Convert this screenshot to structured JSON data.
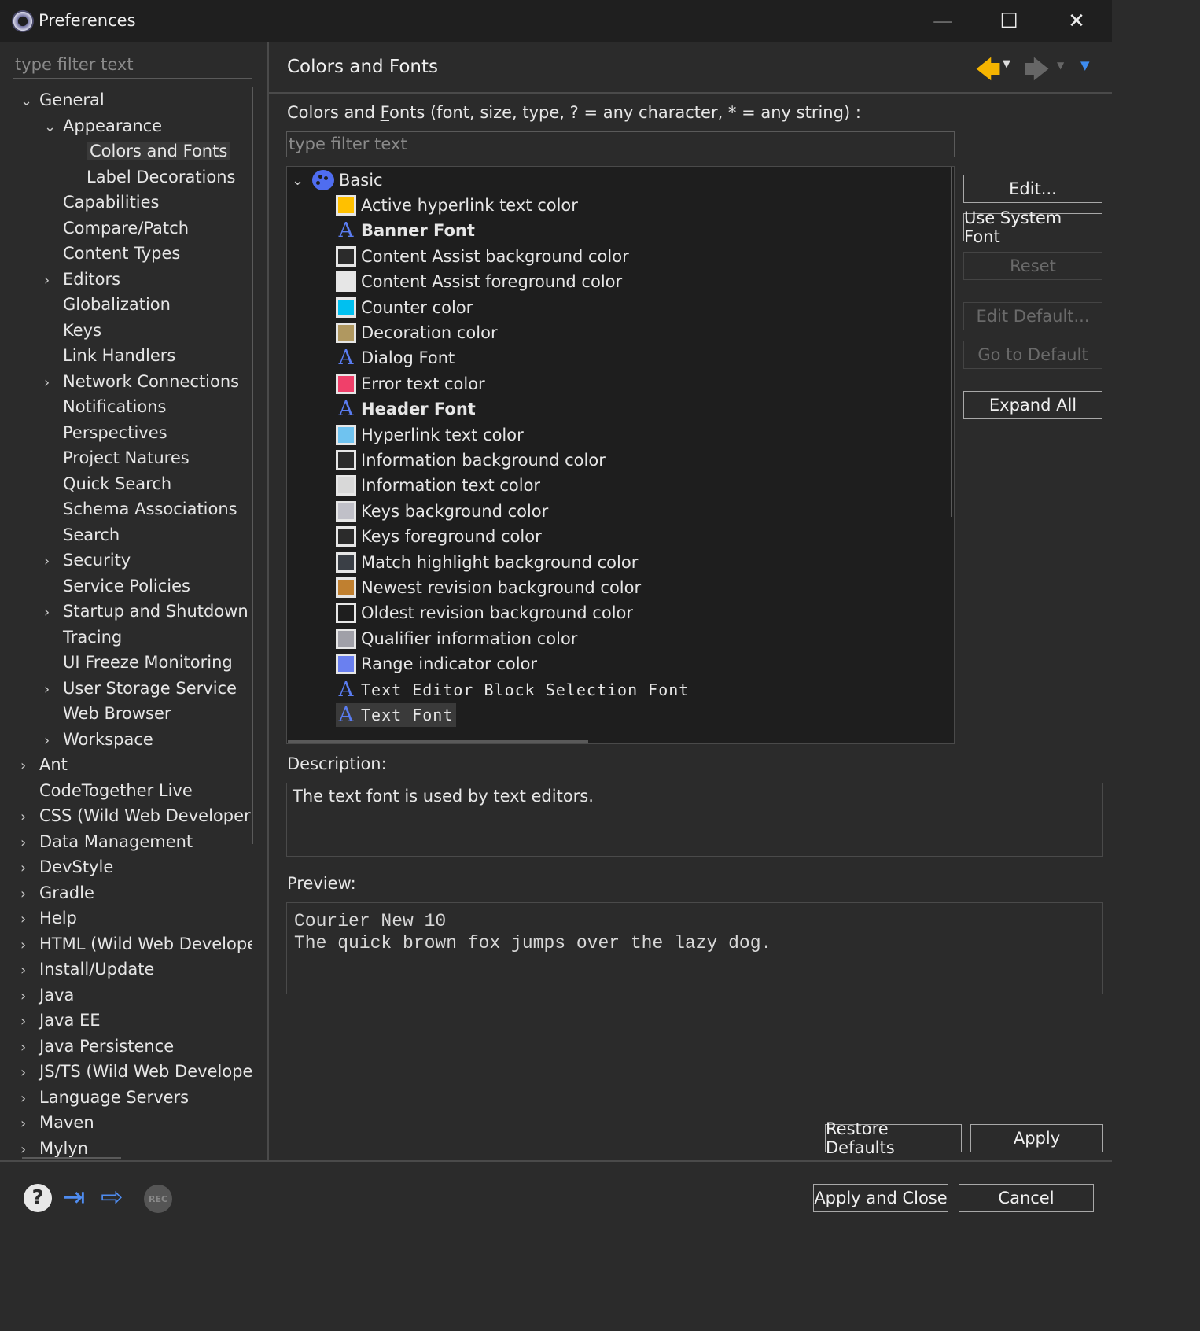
{
  "window": {
    "title": "Preferences",
    "minimize_glyph": "—",
    "maximize_glyph": "☐",
    "close_glyph": "✕"
  },
  "left": {
    "filter_placeholder": "type filter text",
    "tree": [
      {
        "label": "General",
        "level": 0,
        "arrow": "expanded"
      },
      {
        "label": "Appearance",
        "level": 1,
        "arrow": "expanded"
      },
      {
        "label": "Colors and Fonts",
        "level": 2,
        "arrow": "none",
        "selected": true
      },
      {
        "label": "Label Decorations",
        "level": 2,
        "arrow": "none"
      },
      {
        "label": "Capabilities",
        "level": 1,
        "arrow": "none"
      },
      {
        "label": "Compare/Patch",
        "level": 1,
        "arrow": "none"
      },
      {
        "label": "Content Types",
        "level": 1,
        "arrow": "none"
      },
      {
        "label": "Editors",
        "level": 1,
        "arrow": "collapsed"
      },
      {
        "label": "Globalization",
        "level": 1,
        "arrow": "none"
      },
      {
        "label": "Keys",
        "level": 1,
        "arrow": "none"
      },
      {
        "label": "Link Handlers",
        "level": 1,
        "arrow": "none"
      },
      {
        "label": "Network Connections",
        "level": 1,
        "arrow": "collapsed"
      },
      {
        "label": "Notifications",
        "level": 1,
        "arrow": "none"
      },
      {
        "label": "Perspectives",
        "level": 1,
        "arrow": "none"
      },
      {
        "label": "Project Natures",
        "level": 1,
        "arrow": "none"
      },
      {
        "label": "Quick Search",
        "level": 1,
        "arrow": "none"
      },
      {
        "label": "Schema Associations",
        "level": 1,
        "arrow": "none"
      },
      {
        "label": "Search",
        "level": 1,
        "arrow": "none"
      },
      {
        "label": "Security",
        "level": 1,
        "arrow": "collapsed"
      },
      {
        "label": "Service Policies",
        "level": 1,
        "arrow": "none"
      },
      {
        "label": "Startup and Shutdown",
        "level": 1,
        "arrow": "collapsed"
      },
      {
        "label": "Tracing",
        "level": 1,
        "arrow": "none"
      },
      {
        "label": "UI Freeze Monitoring",
        "level": 1,
        "arrow": "none"
      },
      {
        "label": "User Storage Service",
        "level": 1,
        "arrow": "collapsed"
      },
      {
        "label": "Web Browser",
        "level": 1,
        "arrow": "none"
      },
      {
        "label": "Workspace",
        "level": 1,
        "arrow": "collapsed"
      },
      {
        "label": "Ant",
        "level": 0,
        "arrow": "collapsed"
      },
      {
        "label": "CodeTogether Live",
        "level": 0,
        "arrow": "none"
      },
      {
        "label": "CSS (Wild Web Developer)",
        "level": 0,
        "arrow": "collapsed"
      },
      {
        "label": "Data Management",
        "level": 0,
        "arrow": "collapsed"
      },
      {
        "label": "DevStyle",
        "level": 0,
        "arrow": "collapsed"
      },
      {
        "label": "Gradle",
        "level": 0,
        "arrow": "collapsed"
      },
      {
        "label": "Help",
        "level": 0,
        "arrow": "collapsed"
      },
      {
        "label": "HTML (Wild Web Developer)",
        "level": 0,
        "arrow": "collapsed"
      },
      {
        "label": "Install/Update",
        "level": 0,
        "arrow": "collapsed"
      },
      {
        "label": "Java",
        "level": 0,
        "arrow": "collapsed"
      },
      {
        "label": "Java EE",
        "level": 0,
        "arrow": "collapsed"
      },
      {
        "label": "Java Persistence",
        "level": 0,
        "arrow": "collapsed"
      },
      {
        "label": "JS/TS (Wild Web Developer)",
        "level": 0,
        "arrow": "collapsed"
      },
      {
        "label": "Language Servers",
        "level": 0,
        "arrow": "collapsed"
      },
      {
        "label": "Maven",
        "level": 0,
        "arrow": "collapsed"
      },
      {
        "label": "Mylyn",
        "level": 0,
        "arrow": "collapsed"
      }
    ]
  },
  "main": {
    "page_title": "Colors and Fonts",
    "filter_label_pre": "Colors and ",
    "filter_label_mnemonic": "F",
    "filter_label_post": "onts (font, size, type, ? = any character, * = any string) :",
    "filter_placeholder": "type filter text",
    "category": "Basic",
    "items": [
      {
        "type": "color",
        "label": "Active hyperlink text color",
        "color": "#FFC000"
      },
      {
        "type": "font",
        "label": "Banner Font",
        "style": "bold"
      },
      {
        "type": "color",
        "label": "Content Assist background color",
        "color": "#2B2B2B"
      },
      {
        "type": "color",
        "label": "Content Assist foreground color",
        "color": "#E6E6E6"
      },
      {
        "type": "color",
        "label": "Counter color",
        "color": "#00C0F0"
      },
      {
        "type": "color",
        "label": "Decoration color",
        "color": "#B09860"
      },
      {
        "type": "font",
        "label": "Dialog Font",
        "style": "normal"
      },
      {
        "type": "color",
        "label": "Error text color",
        "color": "#F0406A"
      },
      {
        "type": "font",
        "label": "Header Font",
        "style": "bold"
      },
      {
        "type": "color",
        "label": "Hyperlink text color",
        "color": "#6FC3F0"
      },
      {
        "type": "color",
        "label": "Information background color",
        "color": "#2B2B2B"
      },
      {
        "type": "color",
        "label": "Information text color",
        "color": "#D8D8D8"
      },
      {
        "type": "color",
        "label": "Keys background color",
        "color": "#C0C0C8"
      },
      {
        "type": "color",
        "label": "Keys foreground color",
        "color": "#2B2B2B"
      },
      {
        "type": "color",
        "label": "Match highlight background color",
        "color": "#3A3F46"
      },
      {
        "type": "color",
        "label": "Newest revision background color",
        "color": "#C08030"
      },
      {
        "type": "color",
        "label": "Oldest revision background color",
        "color": "#1E1E1E"
      },
      {
        "type": "color",
        "label": "Qualifier information color",
        "color": "#A0A0A8"
      },
      {
        "type": "color",
        "label": "Range indicator color",
        "color": "#6A80F0"
      },
      {
        "type": "font",
        "label": "Text Editor Block Selection Font",
        "style": "mono"
      },
      {
        "type": "font",
        "label": "Text Font",
        "style": "mono",
        "selected": true
      }
    ],
    "side_buttons": {
      "edit": "Edit...",
      "use_system_font": "Use System Font",
      "reset": "Reset",
      "edit_default": "Edit Default...",
      "go_to_default": "Go to Default",
      "expand_all": "Expand All"
    },
    "description_label": "Description:",
    "description_text": "The text font is used by text editors.",
    "preview_label": "Preview:",
    "preview_lines": [
      "Courier New 10",
      "The quick brown fox jumps over the lazy dog."
    ],
    "restore_defaults": "Restore Defaults",
    "apply": "Apply"
  },
  "footer": {
    "apply_and_close": "Apply and Close",
    "cancel": "Cancel",
    "help_glyph": "?",
    "import_glyph": "⇥",
    "export_glyph": "⇨",
    "rec_label": "REC"
  }
}
